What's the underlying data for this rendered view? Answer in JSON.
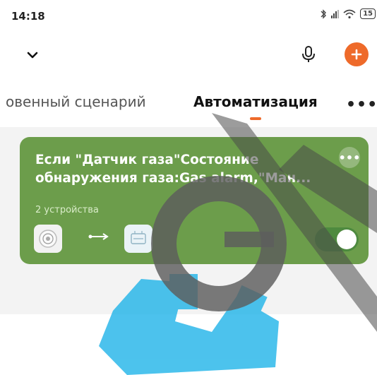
{
  "status_bar": {
    "time": "14:18",
    "battery": "15",
    "icons": [
      "bluetooth-icon",
      "signal-icon",
      "wifi-icon",
      "battery-icon"
    ]
  },
  "top_bar": {
    "collapse_icon": "chevron-down-icon",
    "mic_icon": "microphone-icon",
    "add_icon": "plus-icon",
    "accent_color": "#ee6a2a"
  },
  "tabs": {
    "items": [
      {
        "label": "овенный сценарий",
        "active": false
      },
      {
        "label": "Автоматизация",
        "active": true
      }
    ],
    "more_label": "•••"
  },
  "automation_card": {
    "title": "Если \"Датчик газа\"Состояние обнаружения газа:Gas alarm,\"Ман...",
    "devices_count": "2 устройства",
    "more_label": "•••",
    "enabled": true,
    "card_color": "#6c9d4b",
    "devices": [
      {
        "icon": "gas-sensor-icon"
      },
      {
        "icon": "manipulator-device-icon"
      }
    ]
  }
}
